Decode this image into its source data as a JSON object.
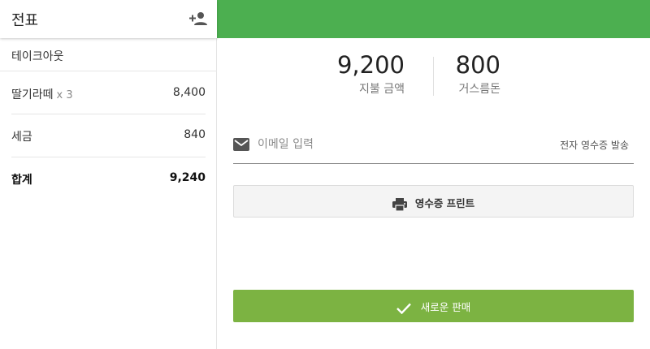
{
  "receipt": {
    "title": "전표",
    "order_type": "테이크아웃",
    "items": [
      {
        "name": "딸기라떼",
        "qty": "x 3",
        "amount": "8,400"
      }
    ],
    "tax_label": "세금",
    "tax_amount": "840",
    "total_label": "합계",
    "total_amount": "9,240"
  },
  "payment": {
    "paid_amount": "9,200",
    "paid_label": "지불 금액",
    "change_amount": "800",
    "change_label": "거스름돈"
  },
  "email": {
    "placeholder": "이메일 입력",
    "send_label": "전자 영수증 발송"
  },
  "actions": {
    "print_label": "영수증 프린트",
    "new_sale_label": "새로운 판매"
  },
  "colors": {
    "topbar": "#4caf50",
    "new_sale": "#7cb342"
  },
  "icons": [
    "add-person-icon",
    "mail-icon",
    "printer-icon",
    "check-icon"
  ]
}
